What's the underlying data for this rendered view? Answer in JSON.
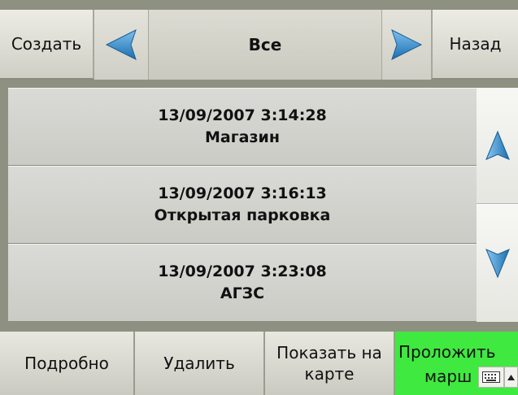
{
  "toolbar": {
    "create_label": "Создать",
    "filter_label": "Все",
    "back_label": "Назад",
    "prev_icon": "arrow-left-icon",
    "next_icon": "arrow-right-icon"
  },
  "list": {
    "items": [
      {
        "datetime": "13/09/2007 3:14:28",
        "name": "Магазин"
      },
      {
        "datetime": "13/09/2007 3:16:13",
        "name": "Открытая парковка"
      },
      {
        "datetime": "13/09/2007 3:23:08",
        "name": "АГЗС"
      }
    ],
    "scroll_up_icon": "arrow-up-icon",
    "scroll_down_icon": "arrow-down-icon"
  },
  "actions": {
    "details_label": "Подробно",
    "delete_label": "Удалить",
    "show_map_line1": "Показать на",
    "show_map_line2": "карте",
    "route_line1": "Проложить",
    "route_line2": "марш"
  },
  "colors": {
    "accent_arrow": "#2e7fbf",
    "route_button": "#3fe93f",
    "background": "#8e9181"
  },
  "keyboard": {
    "icon": "keyboard-icon",
    "toggle_icon": "caret-up-icon"
  }
}
